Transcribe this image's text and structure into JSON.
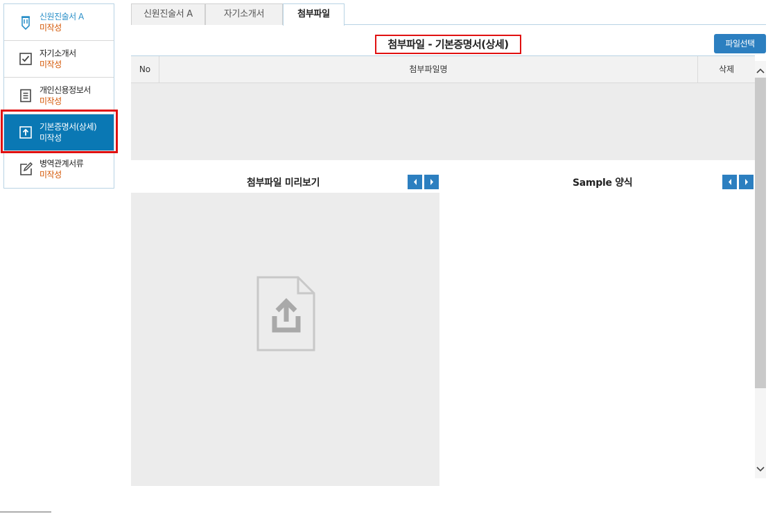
{
  "sidebar": {
    "items": [
      {
        "label": "신원진술서 A",
        "status": "미작성",
        "icon": "pencil-badge-icon"
      },
      {
        "label": "자기소개서",
        "status": "미작성",
        "icon": "checkbox-icon"
      },
      {
        "label": "개인신용정보서",
        "status": "미작성",
        "icon": "document-lines-icon"
      },
      {
        "label": "기본증명서(상세)",
        "status": "미작성",
        "icon": "upload-box-icon",
        "active": true
      },
      {
        "label": "병역관계서류",
        "status": "미작성",
        "icon": "edit-icon"
      }
    ]
  },
  "tabs": [
    {
      "label": "신원진술서 A"
    },
    {
      "label": "자기소개서"
    },
    {
      "label": "첨부파일",
      "active": true
    }
  ],
  "header": {
    "title": "첨부파일 - 기본증명서(상세)",
    "file_select_button": "파일선택"
  },
  "table": {
    "columns": [
      "No",
      "첨부파일명",
      "삭제"
    ],
    "rows": []
  },
  "preview": {
    "left_title": "첨부파일 미리보기",
    "right_title": "Sample 양식",
    "placeholder_icon": "file-upload-icon"
  },
  "colors": {
    "accent": "#0a78b4",
    "button": "#2c7fc0",
    "status": "#d35400",
    "highlight": "#e01010"
  }
}
